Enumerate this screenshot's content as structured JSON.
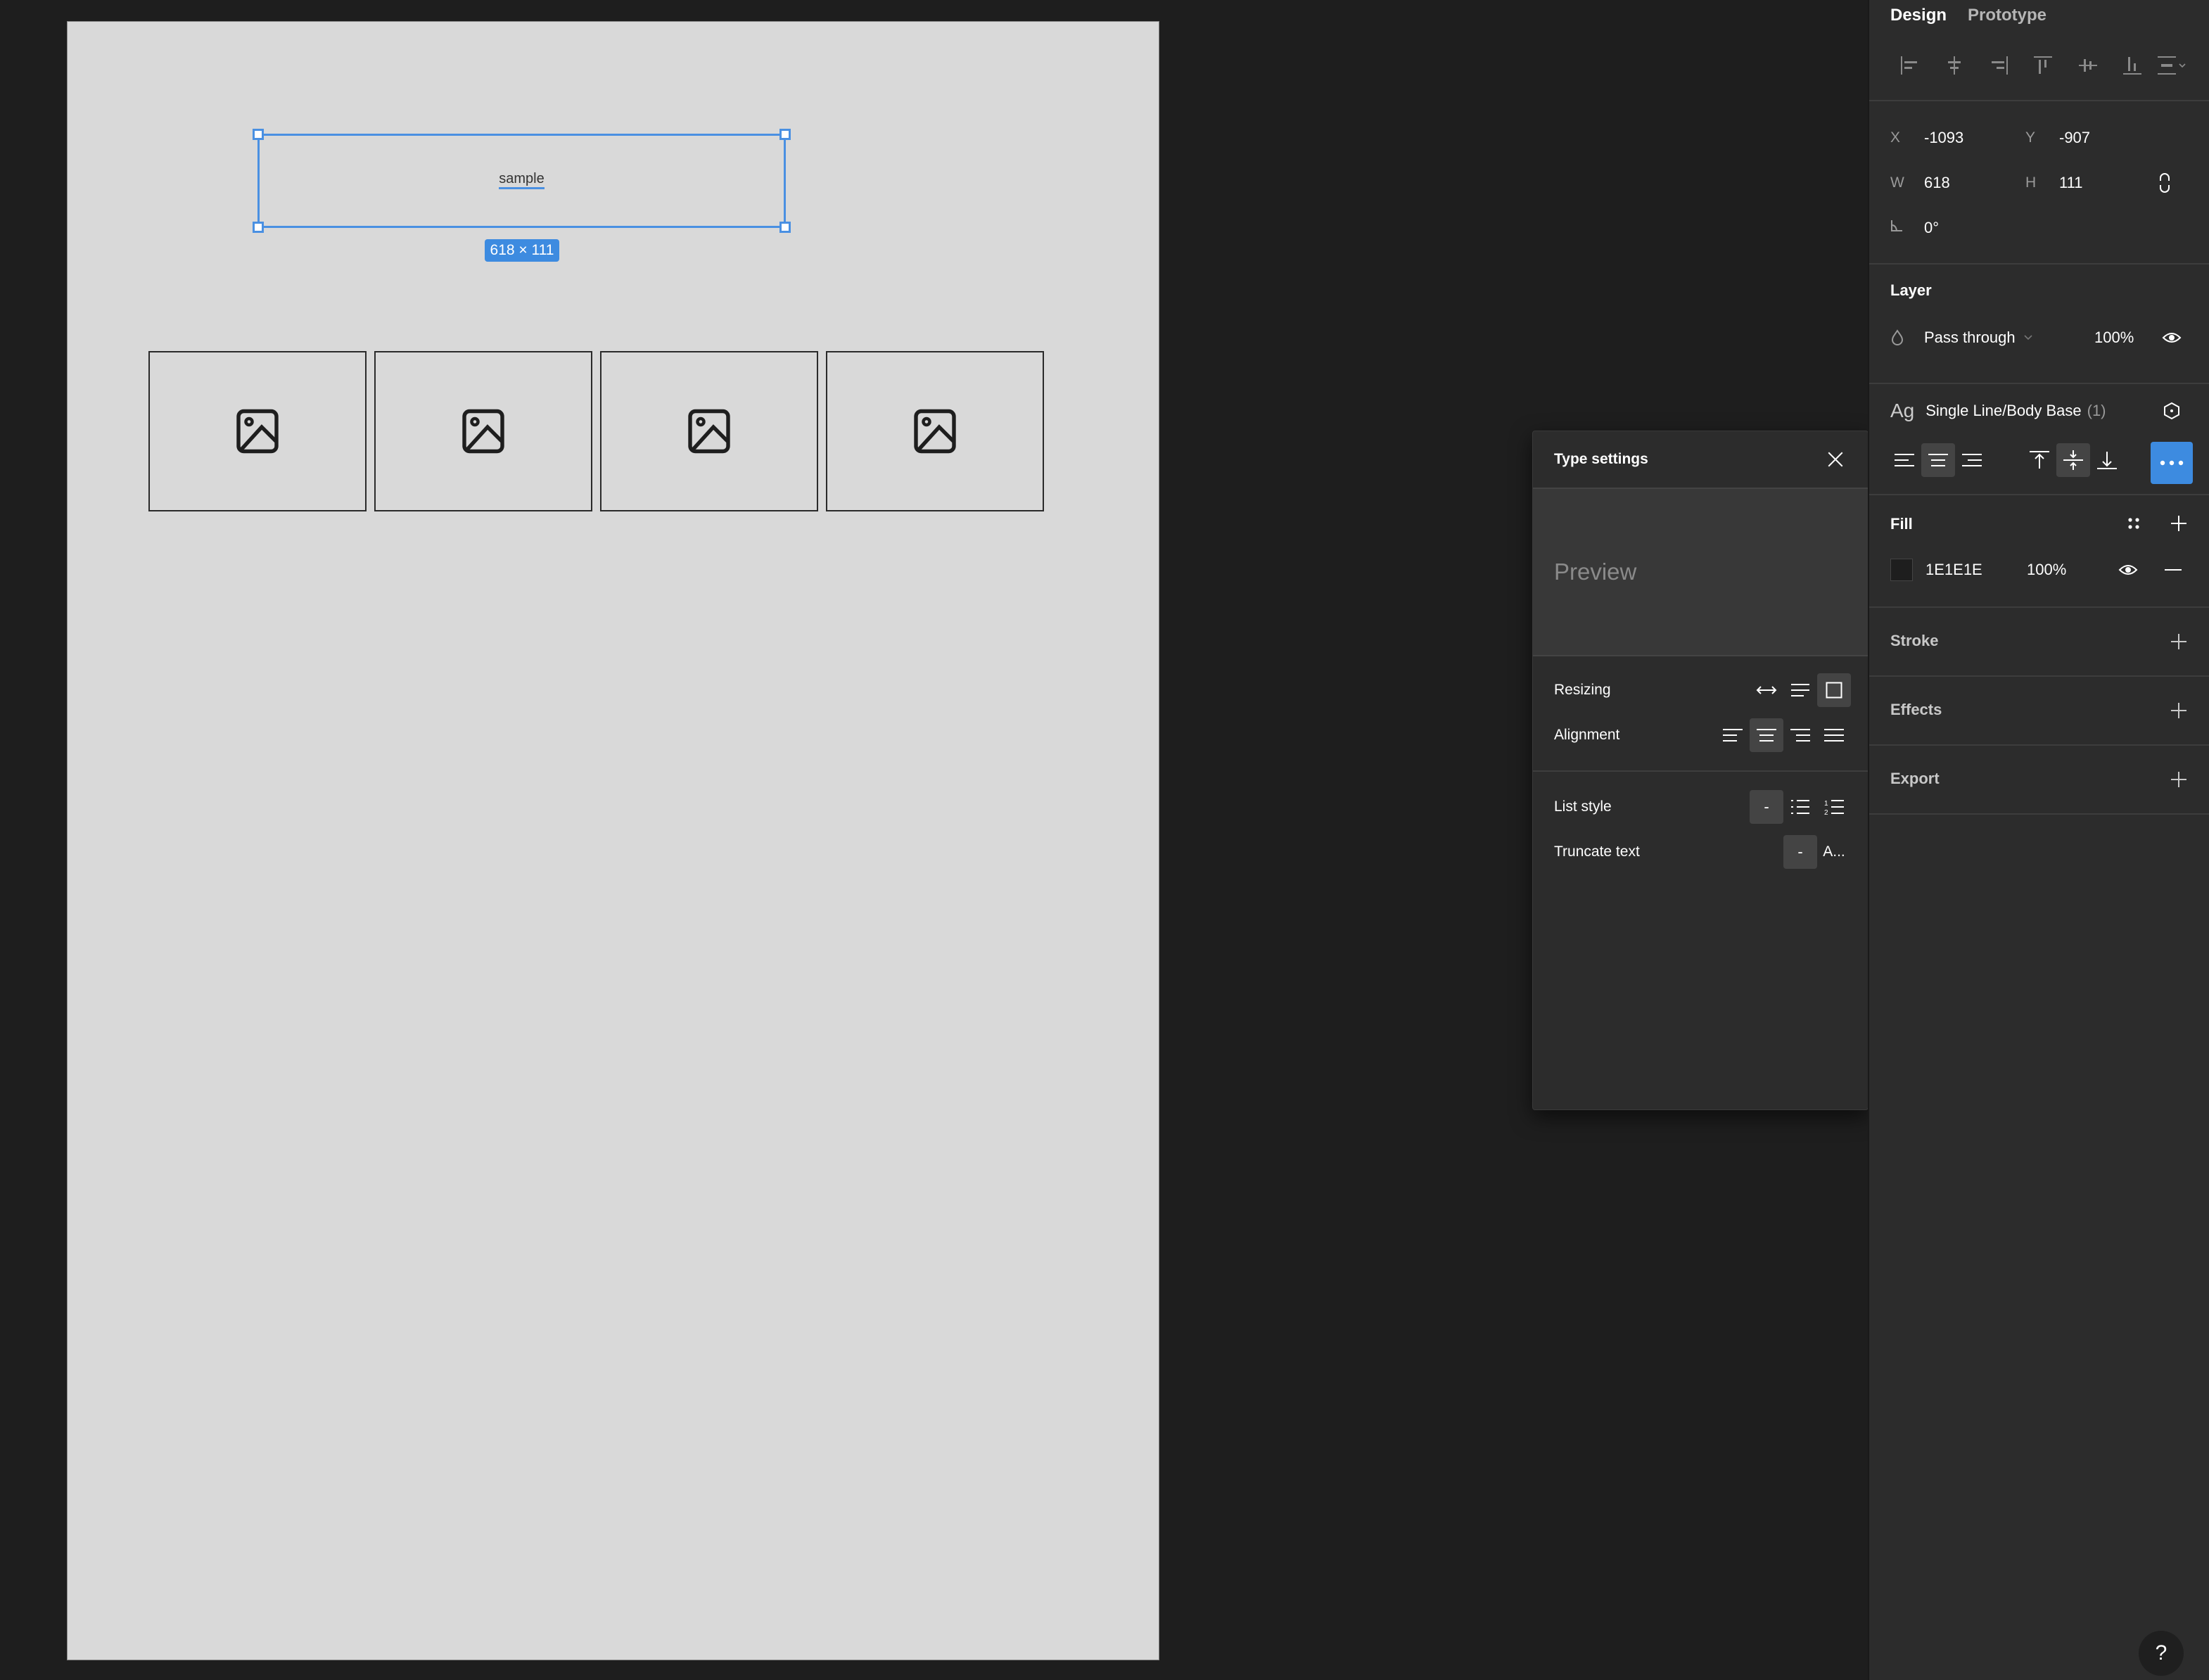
{
  "canvas": {
    "selected_text": "sample",
    "dimension_label": "618 × 111",
    "placeholders": [
      {
        "icon": "image-icon"
      },
      {
        "icon": "image-icon"
      },
      {
        "icon": "image-icon"
      },
      {
        "icon": "image-icon"
      }
    ],
    "frame_color": "#D9D9D9",
    "selection_color": "#4A90E2"
  },
  "type_settings": {
    "title": "Type settings",
    "close_icon": "close-icon",
    "preview": "Preview",
    "rows": {
      "resizing": {
        "label": "Resizing",
        "options": [
          "auto-width",
          "auto-height",
          "fixed-size"
        ],
        "selected": "fixed-size"
      },
      "alignment": {
        "label": "Alignment",
        "options": [
          "left",
          "center",
          "right",
          "justified"
        ],
        "selected": "center"
      },
      "list_style": {
        "label": "List style",
        "none_label": "-",
        "options": [
          "none",
          "bulleted",
          "numbered"
        ],
        "selected": "none"
      },
      "truncate": {
        "label": "Truncate text",
        "none_label": "-",
        "ellipsis_label": "A...",
        "selected": "none"
      }
    }
  },
  "panel": {
    "tabs": [
      {
        "label": "Design",
        "active": true
      },
      {
        "label": "Prototype",
        "active": false
      }
    ],
    "align_tools": [
      "align-left",
      "align-horizontal-center",
      "align-right",
      "align-top",
      "align-vertical-center",
      "align-bottom",
      "distribute"
    ],
    "position": {
      "x_label": "X",
      "x": "-1093",
      "y_label": "Y",
      "y": "-907",
      "w_label": "W",
      "w": "618",
      "h_label": "H",
      "h": "111",
      "rotation": "0°"
    },
    "layer": {
      "title": "Layer",
      "blend_mode": "Pass through",
      "opacity": "100%"
    },
    "text": {
      "style_prefix": "Ag",
      "style_name": "Single Line/Body Base",
      "style_count": "(1)",
      "horizontal_align": [
        "left",
        "center",
        "right"
      ],
      "horizontal_selected": "center",
      "vertical_align": [
        "top",
        "middle",
        "bottom"
      ],
      "vertical_selected": "middle",
      "more_active": true
    },
    "fill": {
      "title": "Fill",
      "hex": "1E1E1E",
      "swatch": "#1E1E1E",
      "opacity": "100%"
    },
    "stroke": {
      "title": "Stroke"
    },
    "effects": {
      "title": "Effects"
    },
    "export": {
      "title": "Export"
    },
    "accent_color": "#3D8BE0"
  },
  "help": {
    "label": "?"
  }
}
